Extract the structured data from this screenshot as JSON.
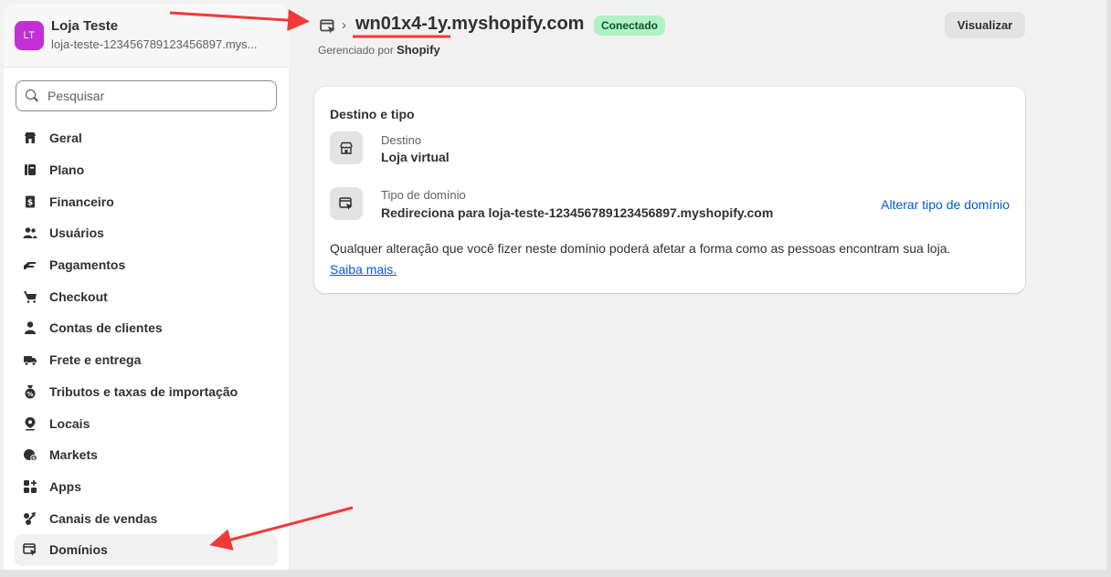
{
  "store": {
    "avatar_initials": "LT",
    "name": "Loja Teste",
    "domain": "loja-teste-123456789123456897.mys..."
  },
  "search": {
    "placeholder": "Pesquisar",
    "icon": "search-icon"
  },
  "nav": [
    {
      "label": "Geral",
      "icon": "store-icon"
    },
    {
      "label": "Plano",
      "icon": "plan-icon"
    },
    {
      "label": "Financeiro",
      "icon": "billing-icon"
    },
    {
      "label": "Usuários",
      "icon": "users-icon"
    },
    {
      "label": "Pagamentos",
      "icon": "payments-icon"
    },
    {
      "label": "Checkout",
      "icon": "cart-icon"
    },
    {
      "label": "Contas de clientes",
      "icon": "person-icon"
    },
    {
      "label": "Frete e entrega",
      "icon": "truck-icon"
    },
    {
      "label": "Tributos e taxas de importação",
      "icon": "tax-icon"
    },
    {
      "label": "Locais",
      "icon": "location-icon"
    },
    {
      "label": "Markets",
      "icon": "globe-icon"
    },
    {
      "label": "Apps",
      "icon": "apps-icon"
    },
    {
      "label": "Canais de vendas",
      "icon": "channels-icon"
    },
    {
      "label": "Domínios",
      "icon": "domain-icon",
      "active": true
    }
  ],
  "header": {
    "title": "wn01x4-1y.myshopify.com",
    "status": "Conectado",
    "managed_prefix": "Gerenciado por",
    "managed_by": "Shopify",
    "view_button": "Visualizar"
  },
  "card": {
    "title": "Destino e tipo",
    "destination_label": "Destino",
    "destination_value": "Loja virtual",
    "type_label": "Tipo de domínio",
    "type_value": "Redireciona para loja-teste-123456789123456897.myshopify.com",
    "change_link": "Alterar tipo de domínio",
    "note": "Qualquer alteração que você fizer neste domínio poderá afetar a forma como as pessoas encontram sua loja.",
    "learn_more": "Saiba mais."
  },
  "colors": {
    "annotation": "#f03a3a",
    "badge_bg": "#aff2c3",
    "link": "#005bd3",
    "avatar": "#c32fd6"
  }
}
